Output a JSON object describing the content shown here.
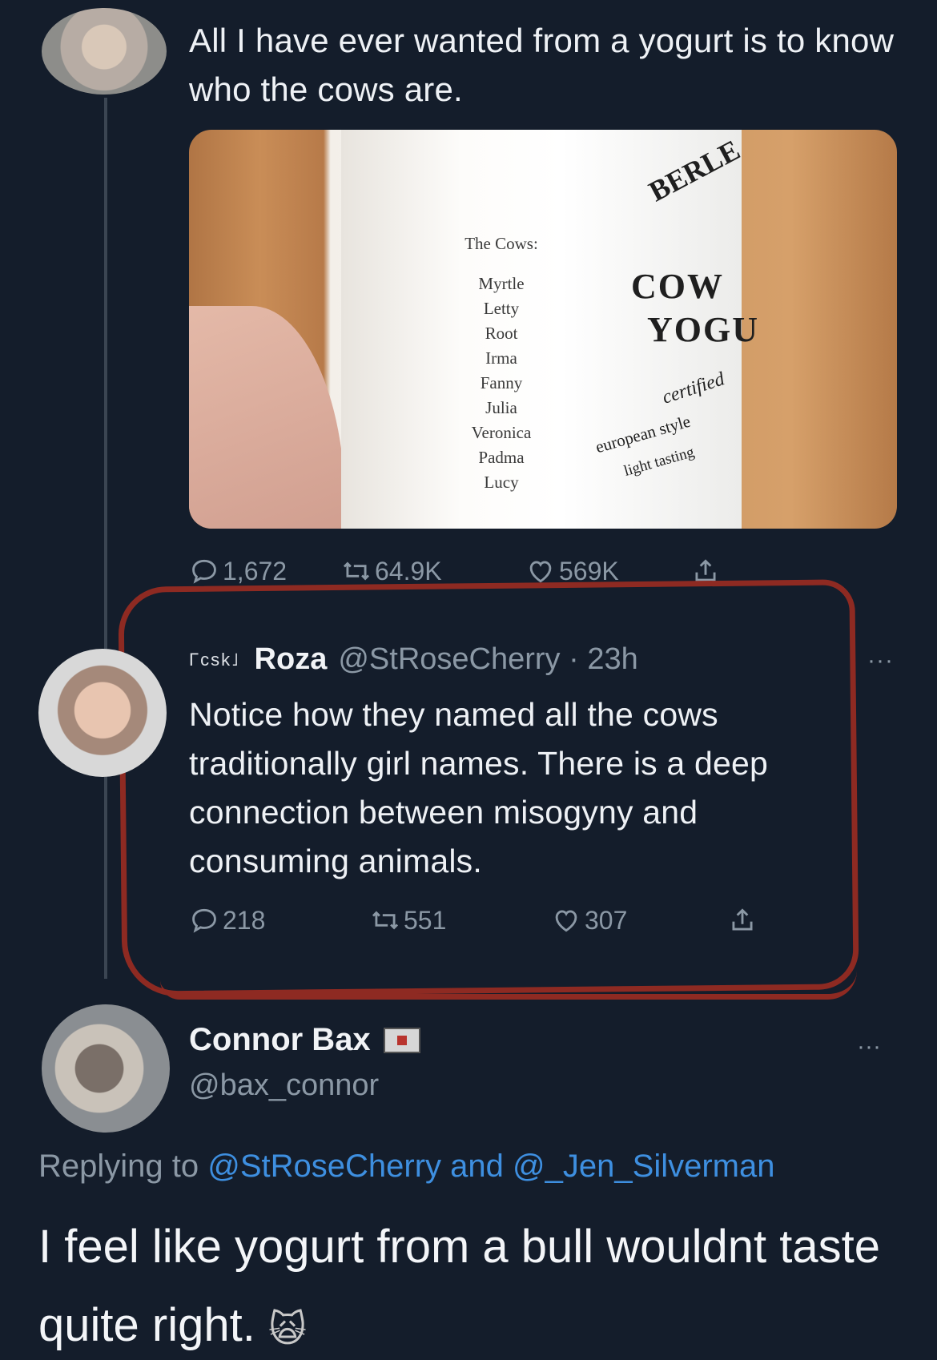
{
  "tweet1": {
    "text": "All I have ever wanted from a yogurt is to know who the cows are.",
    "image": {
      "cows_title": "The Cows:",
      "cow_names": [
        "Myrtle",
        "Letty",
        "Root",
        "Irma",
        "Fanny",
        "Julia",
        "Veronica",
        "Padma",
        "Lucy"
      ],
      "brand_top": "BERLE",
      "brand_line1": "COW",
      "brand_line2": "YOGU",
      "cert": "certified",
      "euro": "european style",
      "light": "light tasting"
    },
    "stats": {
      "replies": "1,672",
      "retweets": "64.9K",
      "likes": "569K"
    }
  },
  "tweet2": {
    "flair": "Γcsk˩",
    "display_name": "Roza",
    "handle_time": "@StRoseCherry · 23h",
    "more": "···",
    "text": "Notice how they named all the cows traditionally girl names. There is a deep connection between misogyny and consuming animals.",
    "stats": {
      "replies": "218",
      "retweets": "551",
      "likes": "307"
    }
  },
  "tweet3": {
    "display_name": "Connor Bax",
    "handle": "@bax_connor",
    "more": "···",
    "replying_prefix": "Replying to",
    "mention1": "@StRoseCherry",
    "and": "and",
    "mention2": "@_Jen_Silverman",
    "text": "I feel like yogurt from a bull wouldnt taste quite right.",
    "emoji": "🙀"
  },
  "colors": {
    "background": "#141d2b",
    "muted": "#8b98a5",
    "link": "#3e8fe0",
    "highlight": "#8e2a22"
  }
}
